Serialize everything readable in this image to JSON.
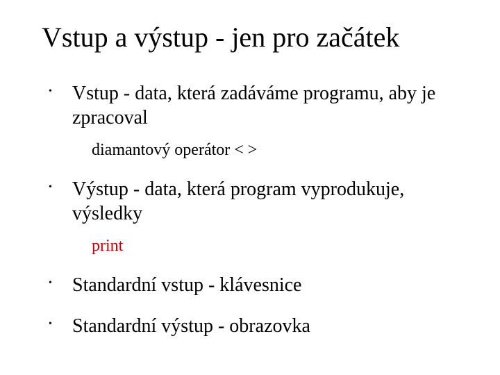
{
  "title": "Vstup a výstup - jen pro začátek",
  "items": [
    {
      "text": "Vstup - data, která zadáváme programu, aby je zpracoval",
      "sub": {
        "text": "diamantový operátor < >",
        "red": false
      }
    },
    {
      "text": "Výstup - data, která program vyprodukuje, výsledky",
      "sub": {
        "text": "print",
        "red": true
      }
    },
    {
      "text": "Standardní vstup - klávesnice"
    },
    {
      "text": "Standardní výstup - obrazovka"
    }
  ]
}
